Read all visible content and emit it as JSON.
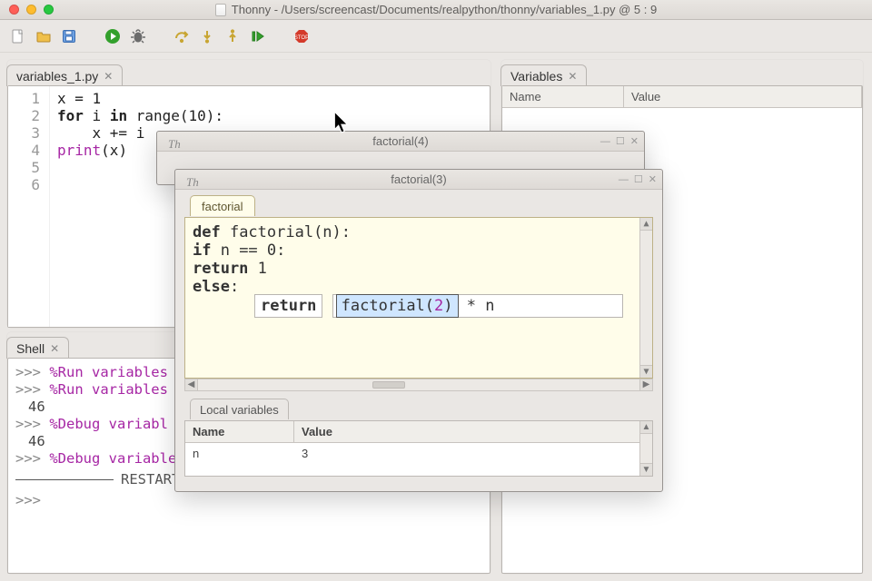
{
  "title": "Thonny  -  /Users/screencast/Documents/realpython/thonny/variables_1.py  @  5 : 9",
  "toolbar": {
    "new": "New",
    "open": "Open",
    "save": "Save",
    "run": "Run",
    "debug": "Debug",
    "step_over": "Step over",
    "step_into": "Step into",
    "step_out": "Step out",
    "resume": "Resume",
    "stop": "Stop"
  },
  "editor": {
    "tab_label": "variables_1.py",
    "gutter": [
      "1",
      "2",
      "3",
      "4",
      "5",
      "6"
    ],
    "lines": [
      [
        {
          "t": "x = ",
          "c": ""
        },
        {
          "t": "1",
          "c": "num"
        }
      ],
      [
        {
          "t": "for",
          "c": "kw"
        },
        {
          "t": " i ",
          "c": ""
        },
        {
          "t": "in",
          "c": "kw"
        },
        {
          "t": " range(",
          "c": ""
        },
        {
          "t": "10",
          "c": "num"
        },
        {
          "t": "):",
          "c": ""
        }
      ],
      [
        {
          "t": "    x += i",
          "c": ""
        }
      ],
      [
        {
          "t": "",
          "c": ""
        }
      ],
      [
        {
          "t": "print",
          "c": "fn"
        },
        {
          "t": "(x)",
          "c": ""
        }
      ],
      [
        {
          "t": "",
          "c": ""
        }
      ]
    ]
  },
  "shell": {
    "tab_label": "Shell",
    "lines": [
      {
        "prompt": ">>>",
        "body": "%Run variables",
        "mag": true
      },
      {
        "prompt": ">>>",
        "body": "%Run variables",
        "mag": true
      },
      {
        "out": "46"
      },
      {
        "prompt": ">>>",
        "body": "%Debug variabl",
        "mag": true
      },
      {
        "out": "46"
      },
      {
        "prompt": ">>>",
        "body": "%Debug variables",
        "mag": true
      },
      {
        "restart": "RESTART"
      },
      {
        "prompt": ">>>",
        "body": ""
      }
    ]
  },
  "variables": {
    "tab_label": "Variables",
    "cols": {
      "name": "Name",
      "value": "Value"
    }
  },
  "popup_back": {
    "title": "factorial(4)",
    "th": "Th"
  },
  "popup_front": {
    "title": "factorial(3)",
    "th": "Th",
    "tab": "factorial",
    "code": {
      "l1": [
        {
          "t": "def",
          "c": "kw2"
        },
        {
          "t": " factorial(n):",
          "c": ""
        }
      ],
      "l2": [
        {
          "t": "    ",
          "c": ""
        },
        {
          "t": "if",
          "c": "kw2"
        },
        {
          "t": " n == ",
          "c": ""
        },
        {
          "t": "0",
          "c": ""
        },
        {
          "t": ":",
          "c": ""
        }
      ],
      "l3": [
        {
          "t": "        ",
          "c": ""
        },
        {
          "t": "return",
          "c": "kw2"
        },
        {
          "t": " 1",
          "c": ""
        }
      ],
      "l4": [
        {
          "t": "    ",
          "c": ""
        },
        {
          "t": "else",
          "c": "kw2"
        },
        {
          "t": ":",
          "c": ""
        }
      ],
      "return_kw": "return",
      "focus_call": "factorial(",
      "focus_arg": "2",
      "focus_close": ")",
      "rest": " * n"
    },
    "locals": {
      "tab": "Local variables",
      "cols": {
        "name": "Name",
        "value": "Value"
      },
      "rows": [
        {
          "name": "n",
          "value": "3"
        }
      ]
    }
  }
}
